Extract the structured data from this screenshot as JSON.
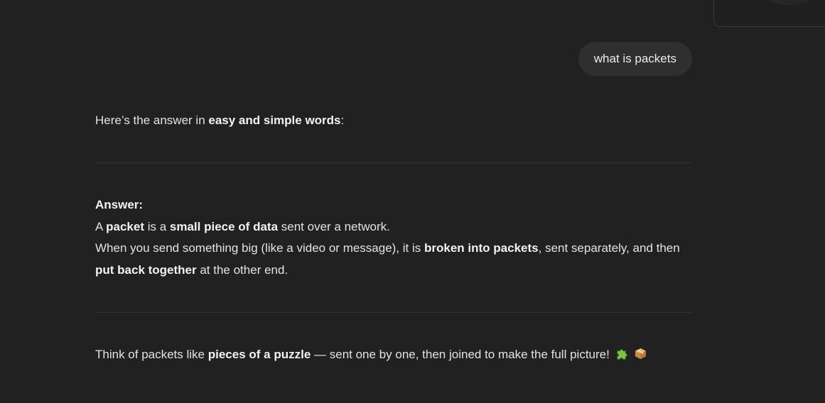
{
  "conversation": {
    "user_message": "what is packets",
    "assistant": {
      "intro": {
        "prefix": "Here’s the answer in ",
        "bold": "easy and simple words",
        "suffix": ":"
      },
      "answer_heading": "Answer:",
      "line1": {
        "p1": "A ",
        "b1": "packet",
        "p2": " is a ",
        "b2": "small piece of data",
        "p3": " sent over a network."
      },
      "line2": {
        "p1": "When you send something big (like a video or message), it is ",
        "b1": "broken into packets",
        "p2": ", sent separately, and then ",
        "b2": "put back together",
        "p3": " at the other end."
      },
      "closing": {
        "p1": "Think of packets like ",
        "b1": "pieces of a puzzle",
        "p2": " — sent one by one, then joined to make the full picture!",
        "emoji_icons": [
          "puzzle-piece-icon",
          "package-icon"
        ]
      }
    }
  }
}
